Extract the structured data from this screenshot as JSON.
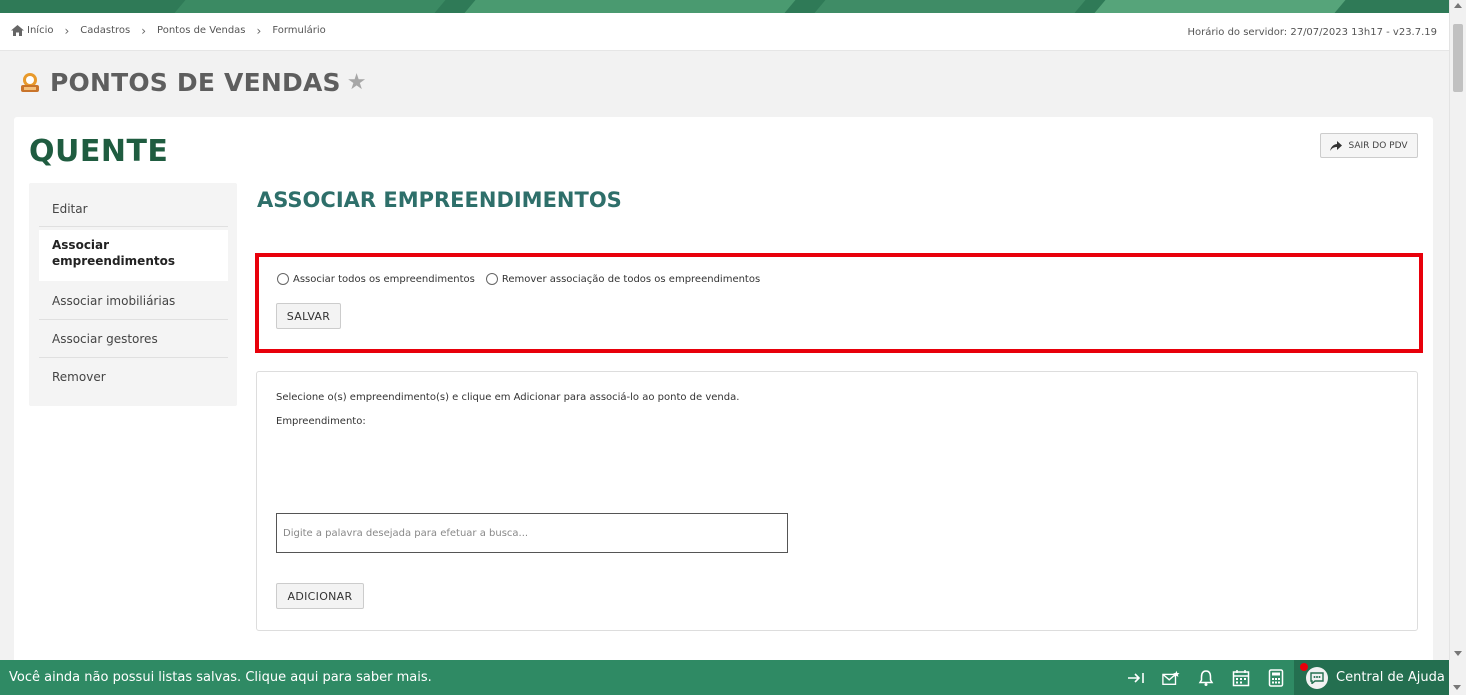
{
  "breadcrumb": {
    "items": [
      "Início",
      "Cadastros",
      "Pontos de Vendas",
      "Formulário"
    ]
  },
  "server_time": "Horário do servidor: 27/07/2023 13h17 - v23.7.19",
  "page": {
    "title": "PONTOS DE VENDAS",
    "icon": "sales-point-icon",
    "favorite_icon": "star-icon"
  },
  "pdv": {
    "name": "QUENTE",
    "exit_label": "SAIR DO PDV"
  },
  "side_menu": {
    "items": [
      {
        "label": "Editar",
        "active": false
      },
      {
        "label": "Associar empreendimentos",
        "active": true
      },
      {
        "label": "Associar imobiliárias",
        "active": false
      },
      {
        "label": "Associar gestores",
        "active": false
      },
      {
        "label": "Remover",
        "active": false
      }
    ]
  },
  "section": {
    "title": "ASSOCIAR EMPREENDIMENTOS"
  },
  "assoc_all": {
    "radio_all_label": "Associar todos os empreendimentos",
    "radio_remove_label": "Remover associação de todos os empreendimentos",
    "save_label": "SALVAR",
    "highlight_color": "#e8000b"
  },
  "selection": {
    "instruction": "Selecione o(s) empreendimento(s) e clique em Adicionar para associá-lo ao ponto de venda.",
    "field_label": "Empreendimento:",
    "search_placeholder": "Digite a palavra desejada para efetuar a busca...",
    "add_label": "ADICIONAR"
  },
  "statusbar": {
    "message": "Você ainda não possui listas salvas. Clique aqui para saber mais.",
    "icons": [
      "collapse-right-icon",
      "mail-star-icon",
      "bell-icon",
      "calendar-icon",
      "calculator-icon"
    ],
    "help_label": "Central de Ajuda"
  },
  "colors": {
    "brand_green": "#2f8a64",
    "dark_green": "#1f5c40",
    "section_title": "#2e6f6a"
  }
}
